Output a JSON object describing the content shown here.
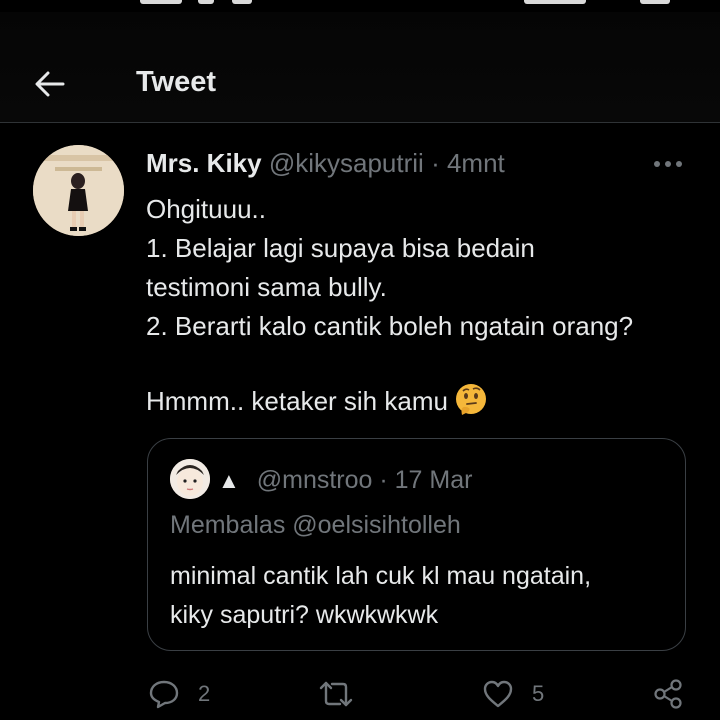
{
  "header": {
    "title": "Tweet",
    "back_icon": "arrow-left-icon"
  },
  "tweet": {
    "author": {
      "name": "Mrs. Kiky",
      "handle": "@kikysaputrii"
    },
    "separator": "·",
    "time": "4mnt",
    "lines": [
      "Ohgituuu..",
      "1. Belajar lagi supaya bisa bedain",
      "testimoni sama bully.",
      "2. Berarti kalo cantik boleh ngatain orang?"
    ],
    "last_line": "Hmmm.. ketaker sih kamu",
    "emoji": "thinking-face-icon"
  },
  "quoted": {
    "badge": "▲",
    "handle": "@mnstroo",
    "separator": "·",
    "date": "17 Mar",
    "reply_to": "Membalas @oelsisihtolleh",
    "lines": [
      "minimal cantik lah cuk kl mau ngatain,",
      "kiky saputri? wkwkwkwk"
    ]
  },
  "actions": {
    "replies": "2",
    "retweets": "",
    "likes": "5"
  },
  "colors": {
    "background": "#000000",
    "text": "#e7e9ea",
    "muted": "#71767b",
    "border": "#2f3336"
  }
}
